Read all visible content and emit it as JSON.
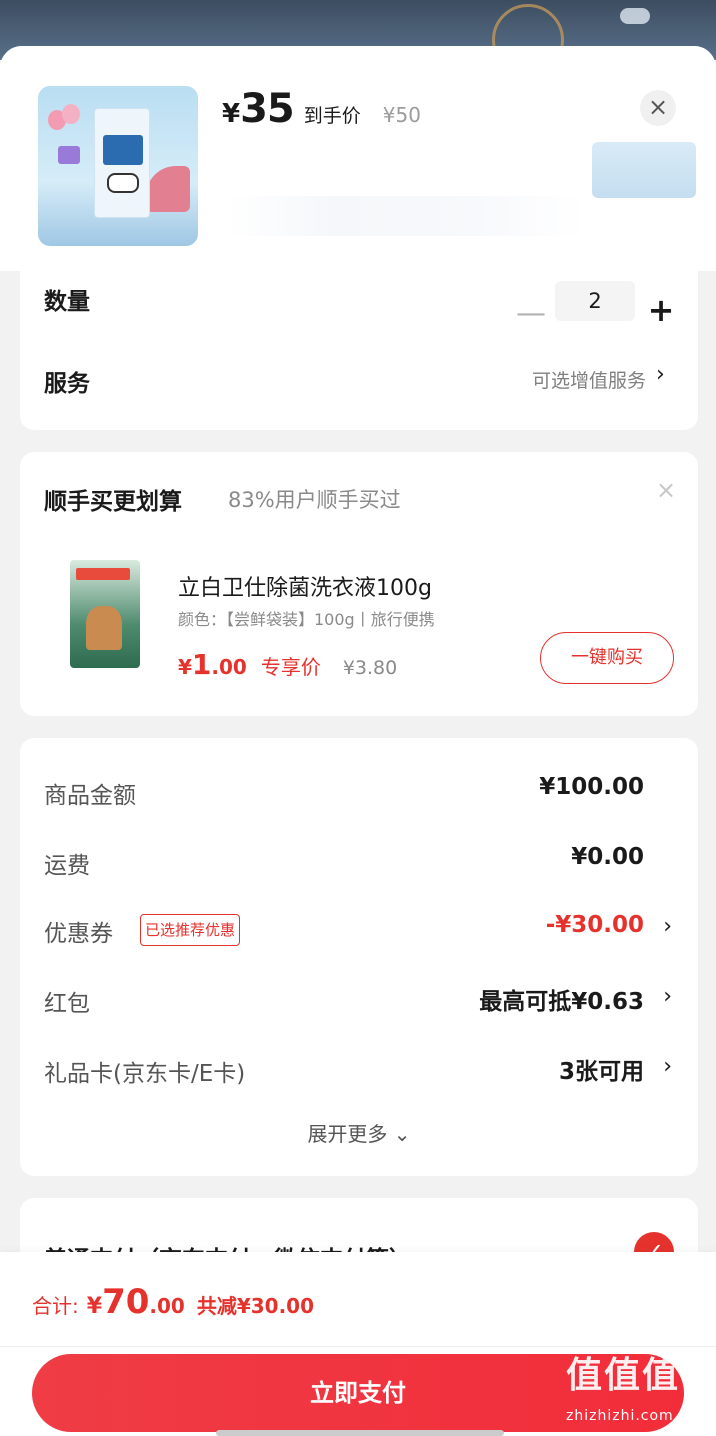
{
  "product": {
    "currency": "¥",
    "price": "35",
    "price_tag": "到手价",
    "original_price": "¥50",
    "close_icon": "×"
  },
  "quantity": {
    "label": "数量",
    "value": "2",
    "minus": "—",
    "plus": "+"
  },
  "service": {
    "label": "服务",
    "value": "可选增值服务",
    "chevron": "›"
  },
  "addon": {
    "title": "顺手买更划算",
    "subtitle": "83%用户顺手买过",
    "close_icon": "×",
    "name": "立白卫仕除菌洗衣液100g",
    "spec": "颜色：【尝鲜袋装】100g丨旅行便携",
    "price_symbol": "¥",
    "price_int": "1",
    "price_dec": ".00",
    "price_tag": "专享价",
    "original_price": "¥3.80",
    "buy_label": "一键购买"
  },
  "summary": {
    "rows": [
      {
        "label": "商品金额",
        "value": "¥100.00"
      },
      {
        "label": "运费",
        "value": "¥0.00"
      },
      {
        "label": "优惠券",
        "badge": "已选推荐优惠",
        "value": "-¥30.00"
      },
      {
        "label": "红包",
        "value": "最高可抵¥0.63"
      },
      {
        "label": "礼品卡(京东卡/E卡)",
        "value": "3张可用"
      }
    ],
    "expand_label": "展开更多 ⌄"
  },
  "payment": {
    "label": "普通支付（京东支付、微信支付等）",
    "check_icon": "✓"
  },
  "footer": {
    "total_label": "合计:",
    "total_symbol": "¥",
    "total_int": "70",
    "total_dec": ".00",
    "saved": "共减¥30.00",
    "pay_label": "立即支付"
  },
  "watermark": {
    "main": "值值值",
    "sub": "zhizhizhi.com"
  },
  "colors": {
    "accent": "#e6322d",
    "pay_button": "#ef3c45"
  }
}
